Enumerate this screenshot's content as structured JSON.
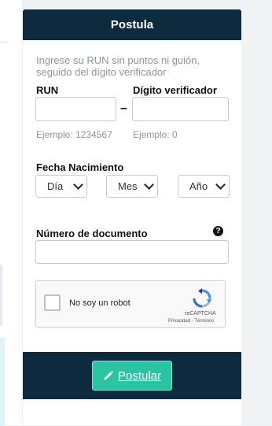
{
  "form": {
    "title": "Postula",
    "instructions": "Ingrese su RUN sin puntos ni guión, seguido del dígito verificador",
    "run_label": "RUN",
    "run_value": "",
    "run_hint": "Ejemplo: 1234567",
    "separator": "–",
    "dv_label": "Dígito verificador",
    "dv_value": "",
    "dv_hint": "Ejemplo: 0",
    "birth_label": "Fecha Nacimiento",
    "day_select": "Día",
    "month_select": "Mes",
    "year_select": "Año",
    "document_label": "Número de documento",
    "document_value": "",
    "help_glyph": "?",
    "submit_label": "Postular"
  },
  "captcha": {
    "label": "No soy un robot",
    "brand": "reCAPTCHA",
    "terms": "Privacidad - Términos",
    "checked": false
  },
  "colors": {
    "header_bg": "#0d2a3f",
    "button_bg": "#2bc4a3",
    "hint_text": "#8c96a0"
  },
  "icons": {
    "help": "question-circle-icon",
    "submit": "pencil-icon",
    "captcha": "recaptcha-logo-icon",
    "select": "chevron-down-icon"
  }
}
